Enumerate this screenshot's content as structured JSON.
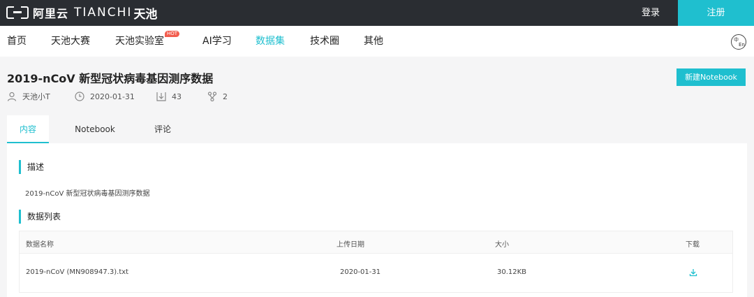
{
  "header": {
    "logo_aliyun": "阿里云",
    "logo_tianchi": "TIANCHI",
    "logo_tianchi_cn": "天池",
    "login": "登录",
    "register": "注册",
    "accent_color": "#1fbfcf",
    "bar_color": "#2a2d32"
  },
  "nav": {
    "items": [
      "首页",
      "天池大赛",
      "天池实验室",
      "AI学习",
      "数据集",
      "技术圈",
      "其他"
    ],
    "active": "数据集",
    "hot_badge": "HOT",
    "lang_zh": "中",
    "lang_en": "En"
  },
  "dataset": {
    "title": "2019-nCoV 新型冠状病毒基因测序数据",
    "new_notebook": "新建Notebook",
    "author": "天池小T",
    "date": "2020-01-31",
    "downloads": "43",
    "forks": "2"
  },
  "tabs": [
    "内容",
    "Notebook",
    "评论"
  ],
  "content": {
    "desc_title": "描述",
    "desc_text": "2019-nCoV 新型冠状病毒基因测序数据",
    "list_title": "数据列表",
    "columns": [
      "数据名称",
      "上传日期",
      "大小",
      "下载"
    ],
    "rows": [
      {
        "name": "2019-nCoV (MN908947.3).txt",
        "date": "2020-01-31",
        "size": "30.12KB"
      }
    ]
  }
}
